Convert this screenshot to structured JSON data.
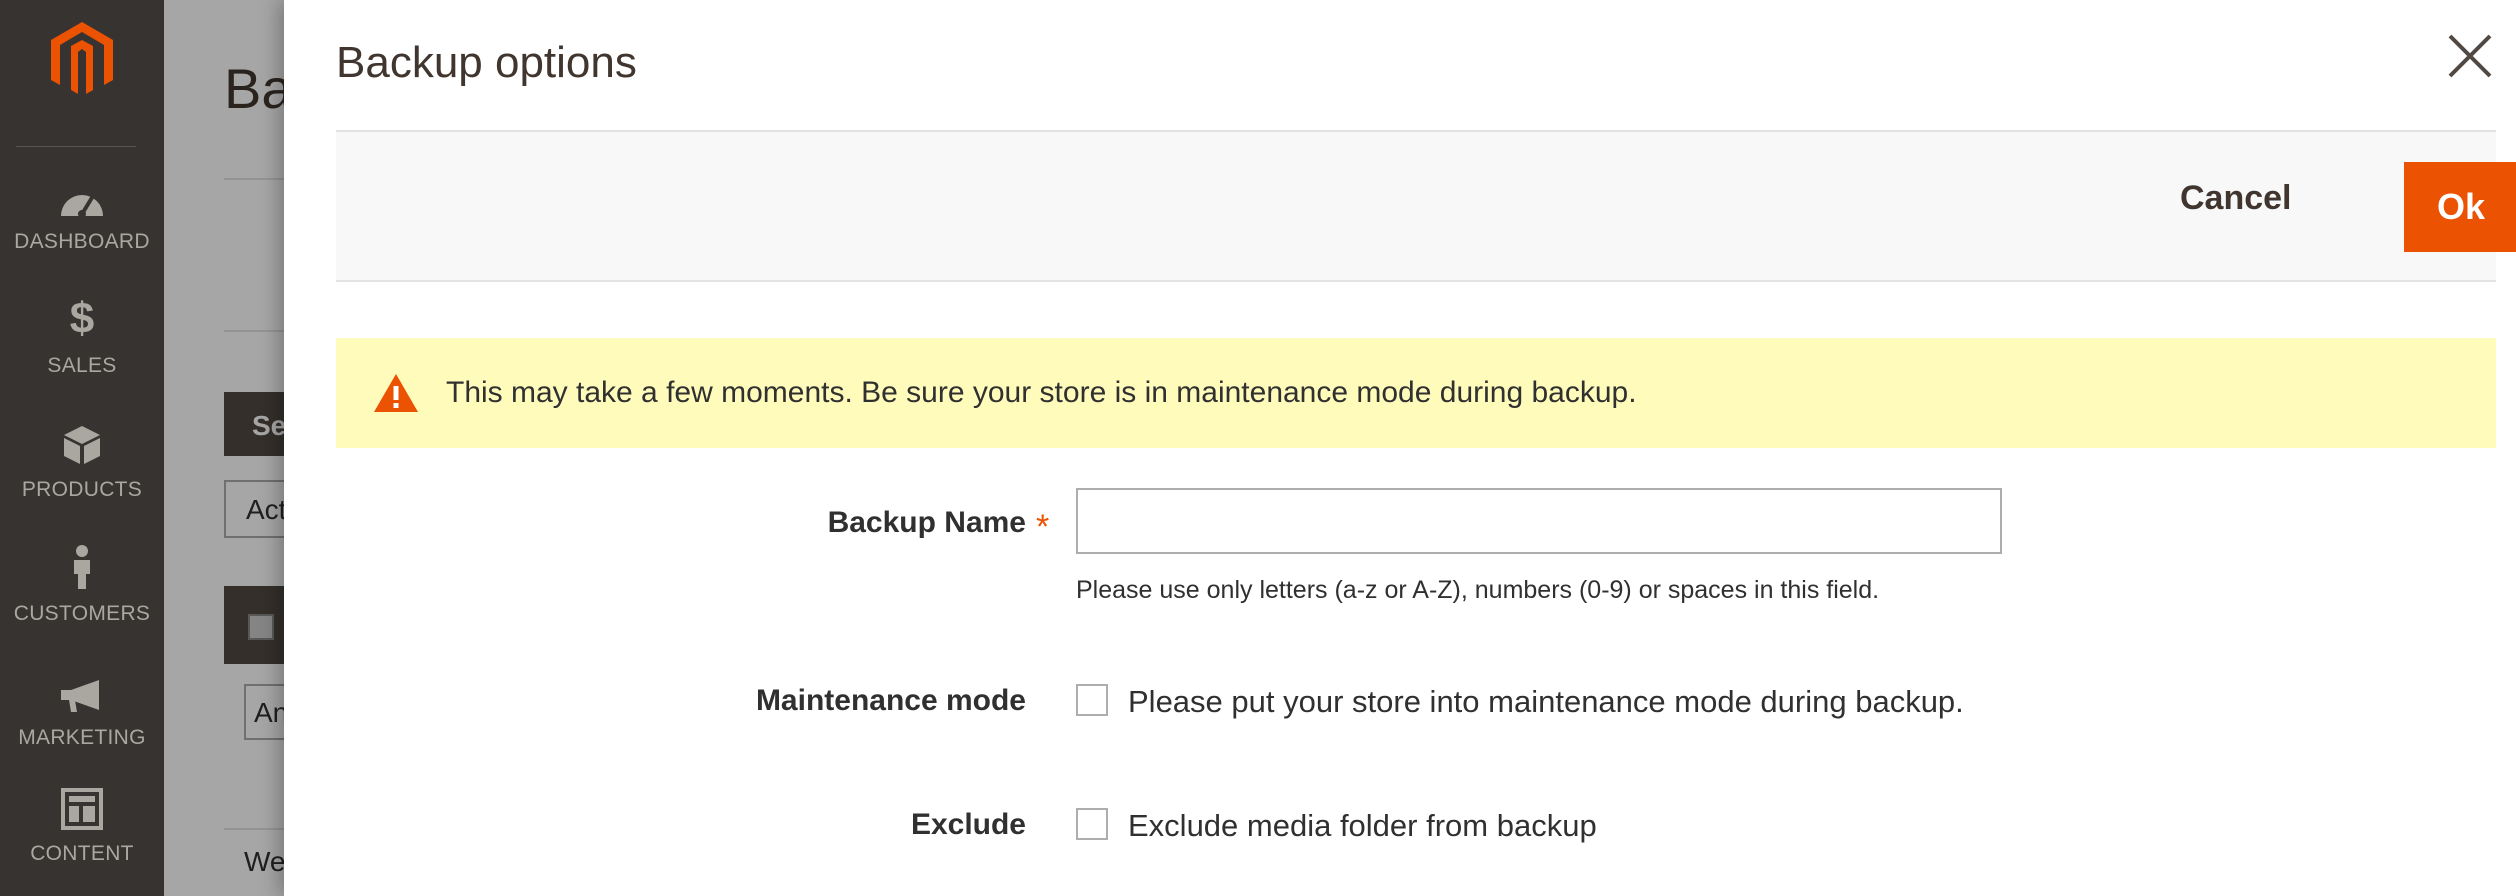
{
  "sidebar": {
    "logo_icon": "magento-logo-icon",
    "items": [
      {
        "label": "DASHBOARD",
        "icon": "speedometer-icon"
      },
      {
        "label": "SALES",
        "icon": "dollar-icon"
      },
      {
        "label": "PRODUCTS",
        "icon": "cube-icon"
      },
      {
        "label": "CUSTOMERS",
        "icon": "person-icon"
      },
      {
        "label": "MARKETING",
        "icon": "megaphone-icon"
      },
      {
        "label": "CONTENT",
        "icon": "layout-icon"
      }
    ]
  },
  "background_page": {
    "title_fragment": "Ba",
    "button_fragment": "Se",
    "select_fragment": "Act",
    "grid_select_fragment": "An",
    "row_fragment": "We"
  },
  "modal": {
    "title": "Backup options",
    "cancel_label": "Cancel",
    "ok_label": "Ok",
    "notice": "This may take a few moments. Be sure your store is in maintenance mode during backup.",
    "fields": {
      "backup_name": {
        "label": "Backup Name",
        "required_marker": "*",
        "value": "",
        "note": "Please use only letters (a-z or A-Z), numbers (0-9) or spaces in this field."
      },
      "maintenance_mode": {
        "label": "Maintenance mode",
        "checkbox_label": "Please put your store into maintenance mode during backup.",
        "checked": false
      },
      "exclude": {
        "label": "Exclude",
        "checkbox_label": "Exclude media folder from backup",
        "checked": false
      }
    }
  },
  "colors": {
    "sidebar_bg": "#373330",
    "accent": "#eb5202",
    "notice_bg": "#fffbbb"
  }
}
